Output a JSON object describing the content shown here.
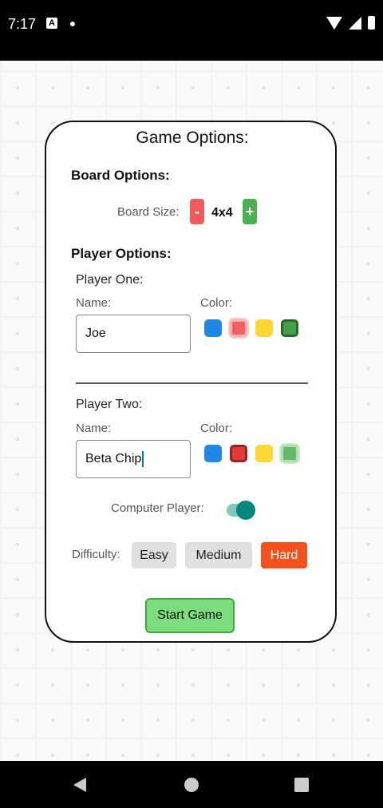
{
  "status": {
    "time": "7:17",
    "notif_icon_letter": "A"
  },
  "title": "Game Options:",
  "board": {
    "section_label": "Board Options:",
    "size_label": "Board Size:",
    "minus_label": "-",
    "size_value": "4x4",
    "plus_label": "+"
  },
  "players": {
    "section_label": "Player Options:",
    "one": {
      "heading": "Player One:",
      "name_label": "Name:",
      "name_value": "Joe",
      "color_label": "Color:",
      "colors": [
        "#1e88e5",
        "#f06060",
        "#fdd835",
        "#43a047"
      ],
      "selected_color_index": 3
    },
    "two": {
      "heading": "Player Two:",
      "name_label": "Name:",
      "name_value": "Beta Chip",
      "color_label": "Color:",
      "colors": [
        "#1e88e5",
        "#e53935",
        "#fdd835",
        "#66bb6a"
      ],
      "selected_color_index": 1
    }
  },
  "computer_player": {
    "label": "Computer Player:",
    "enabled": true
  },
  "difficulty": {
    "label": "Difficulty:",
    "options": [
      "Easy",
      "Medium",
      "Hard"
    ],
    "selected": "Hard"
  },
  "start_button": "Start Game",
  "colors": {
    "accent_teal": "#00897b",
    "hard_selected": "#f4511e",
    "option_bg": "#e0e0e0"
  },
  "icons": [
    "wifi-icon",
    "signal-icon",
    "battery-icon",
    "back-icon",
    "home-icon",
    "recents-icon"
  ]
}
